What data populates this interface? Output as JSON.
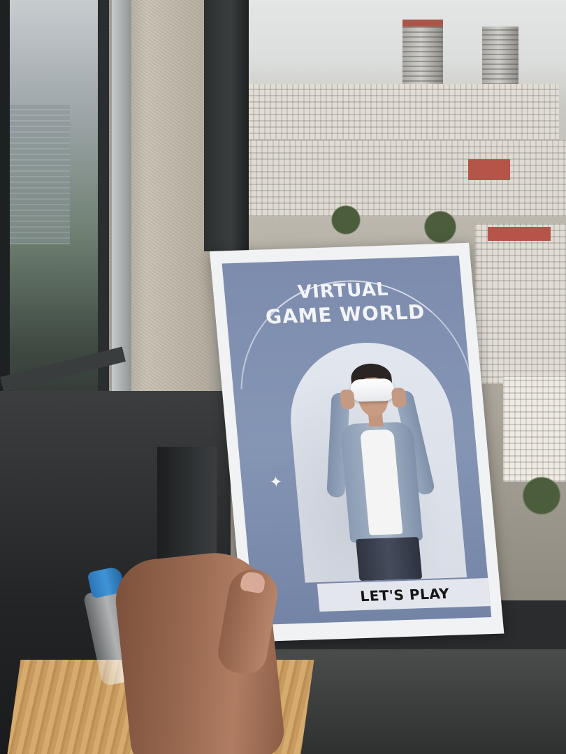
{
  "poster": {
    "title_line1": "VIRTUAL",
    "title_line2": "GAME WORLD",
    "cta_label": "LET'S PLAY"
  },
  "colors": {
    "poster_background": "#7d8cad",
    "poster_border": "#f1f2f4",
    "cta_background": "#e3e6ec",
    "cta_text": "#161616",
    "bottle_cap": "#3f95d8"
  },
  "icons": {
    "sparkle": "four-point-star-icon"
  }
}
